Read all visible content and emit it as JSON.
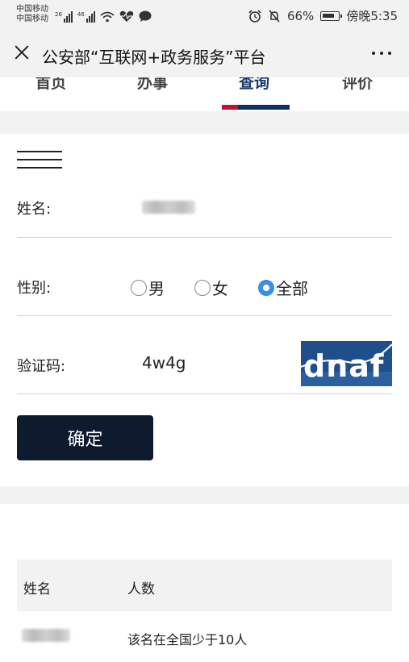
{
  "status_bar": {
    "carrier_1": "中国移动",
    "carrier_2": "中国移动",
    "signal_1_tag": "26",
    "signal_2_tag": "46",
    "battery_percent": "66%",
    "time": "傍晚5:35"
  },
  "nav": {
    "title": "公安部“互联网+政务服务”平台"
  },
  "tabs": [
    {
      "label": "首页"
    },
    {
      "label": "办事"
    },
    {
      "label": "查询"
    },
    {
      "label": "评价"
    }
  ],
  "form": {
    "name_label": "姓名:",
    "gender_label": "性别:",
    "gender_options": [
      "男",
      "女",
      "全部"
    ],
    "gender_selected": "全部",
    "captcha_label": "验证码:",
    "captcha_value": "4w4g",
    "captcha_image_text": "dnaf",
    "confirm_label": "确定"
  },
  "results": {
    "headers": [
      "姓名",
      "人数"
    ],
    "rows": [
      {
        "count_text": "该名在全国少于10人"
      }
    ]
  },
  "colors": {
    "tab_active": "#1b3a6b",
    "tab_underline_red": "#c8102e",
    "tab_underline_blue": "#0d3066",
    "button_bg": "#0e1a2e",
    "radio_checked": "#3a8ee6"
  }
}
